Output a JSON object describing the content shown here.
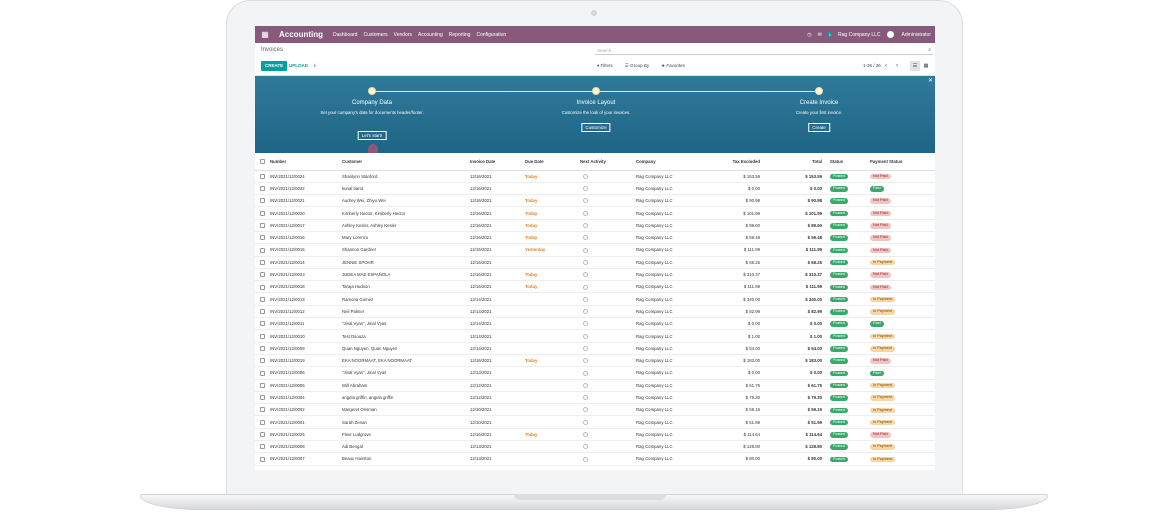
{
  "navbar": {
    "app_name": "Accounting",
    "menu": [
      "Dashboard",
      "Customers",
      "Vendors",
      "Accounting",
      "Reporting",
      "Configuration"
    ],
    "clock_icon": "clock-icon",
    "chat_count": "1",
    "company": "Rag Company LLC",
    "user": "Administrator"
  },
  "control": {
    "breadcrumb": "Invoices",
    "search_placeholder": "Search...",
    "create_label": "CREATE",
    "upload_label": "UPLOAD",
    "filters_label": "Filters",
    "groupby_label": "Group By",
    "favorites_label": "Favorites",
    "pager": "1-36 / 36"
  },
  "banner": {
    "steps": [
      {
        "title": "Company Data",
        "desc": "Set your company's data for documents header/footer.",
        "button": "Let's start!"
      },
      {
        "title": "Invoice Layout",
        "desc": "Customize the look of your invoices.",
        "button": "Customize"
      },
      {
        "title": "Create Invoice",
        "desc": "Create your first invoice.",
        "button": "Create"
      }
    ]
  },
  "table": {
    "headers": [
      "Number",
      "Customer",
      "Invoice Date",
      "Due Date",
      "Next Activity",
      "Company",
      "Tax Excluded",
      "Total",
      "Status",
      "Payment Status"
    ],
    "rows": [
      {
        "number": "INV/2021/12/0024",
        "customer": "Sharilynn Stanford",
        "date": "12/16/2021",
        "due": "Today",
        "company": "Rag Company LLC",
        "tax": "$ 153.59",
        "total": "$ 153.59",
        "status": "Posted",
        "payment": "Not Paid"
      },
      {
        "number": "INV/2021/12/0022",
        "customer": "kunal barot",
        "date": "12/16/2021",
        "due": "",
        "company": "Rag Company LLC",
        "tax": "$ 0.00",
        "total": "$ 0.00",
        "status": "Posted",
        "payment": "Paid"
      },
      {
        "number": "INV/2021/12/0021",
        "customer": "Audrey Wei, Zhiyu Wei",
        "date": "12/16/2021",
        "due": "Today",
        "company": "Rag Company LLC",
        "tax": "$ 90.98",
        "total": "$ 90.98",
        "status": "Posted",
        "payment": "Not Paid"
      },
      {
        "number": "INV/2021/12/0020",
        "customer": "Kimberly Hector, Kimberly Hector",
        "date": "12/16/2021",
        "due": "Today",
        "company": "Rag Company LLC",
        "tax": "$ 101.99",
        "total": "$ 101.99",
        "status": "Posted",
        "payment": "Not Paid"
      },
      {
        "number": "INV/2021/12/0017",
        "customer": "Ashley Kesler, Ashley Kesler",
        "date": "12/16/2021",
        "due": "Today",
        "company": "Rag Company LLC",
        "tax": "$ 89.60",
        "total": "$ 89.60",
        "status": "Posted",
        "payment": "Not Paid"
      },
      {
        "number": "INV/2021/12/0016",
        "customer": "Mary Lorenzo",
        "date": "12/16/2021",
        "due": "Today",
        "company": "Rag Company LLC",
        "tax": "$ 59.48",
        "total": "$ 59.48",
        "status": "Posted",
        "payment": "Not Paid"
      },
      {
        "number": "INV/2021/12/0015",
        "customer": "Shannon Gardner",
        "date": "12/15/2021",
        "due": "Yesterday",
        "company": "Rag Company LLC",
        "tax": "$ 111.99",
        "total": "$ 111.99",
        "status": "Posted",
        "payment": "Not Paid"
      },
      {
        "number": "INV/2021/12/0014",
        "customer": "JENNIE SPOHR",
        "date": "12/16/2021",
        "due": "",
        "company": "Rag Company LLC",
        "tax": "$ 68.25",
        "total": "$ 68.25",
        "status": "Posted",
        "payment": "In Payment"
      },
      {
        "number": "INV/2021/12/0023",
        "customer": "JUDEA MAE ESPAÑOLA",
        "date": "12/16/2021",
        "due": "Today",
        "company": "Rag Company LLC",
        "tax": "$ 310.37",
        "total": "$ 310.37",
        "status": "Posted",
        "payment": "Not Paid"
      },
      {
        "number": "INV/2021/12/0018",
        "customer": "Taraja Hudson",
        "date": "12/16/2021",
        "due": "Today",
        "company": "Rag Company LLC",
        "tax": "$ 111.99",
        "total": "$ 111.99",
        "status": "Posted",
        "payment": "Not Paid"
      },
      {
        "number": "INV/2021/12/0013",
        "customer": "Ramona Gomez",
        "date": "12/14/2021",
        "due": "",
        "company": "Rag Company LLC",
        "tax": "$ 340.00",
        "total": "$ 340.00",
        "status": "Posted",
        "payment": "In Payment"
      },
      {
        "number": "INV/2021/12/0012",
        "customer": "Neil Palmer",
        "date": "12/14/2021",
        "due": "",
        "company": "Rag Company LLC",
        "tax": "$ 82.99",
        "total": "$ 82.99",
        "status": "Posted",
        "payment": "In Payment"
      },
      {
        "number": "INV/2021/12/0011",
        "customer": "\"Jinal Vyas\", Jinal Vyas",
        "date": "12/14/2021",
        "due": "",
        "company": "Rag Company LLC",
        "tax": "$ 0.00",
        "total": "$ 0.00",
        "status": "Posted",
        "payment": "Paid"
      },
      {
        "number": "INV/2021/12/0010",
        "customer": "Test Dsouza",
        "date": "12/14/2021",
        "due": "",
        "company": "Rag Company LLC",
        "tax": "$ 1.00",
        "total": "$ 1.00",
        "status": "Posted",
        "payment": "In Payment"
      },
      {
        "number": "INV/2021/12/0009",
        "customer": "Quan Nguyen, Quan Nguyen",
        "date": "12/14/2021",
        "due": "",
        "company": "Rag Company LLC",
        "tax": "$ 54.00",
        "total": "$ 54.00",
        "status": "Posted",
        "payment": "In Payment"
      },
      {
        "number": "INV/2021/12/0019",
        "customer": "EKA NOORMAAT, EKA NOORMAAT",
        "date": "12/16/2021",
        "due": "Today",
        "company": "Rag Company LLC",
        "tax": "$ 183.00",
        "total": "$ 183.00",
        "status": "Posted",
        "payment": "Not Paid"
      },
      {
        "number": "INV/2021/12/0006",
        "customer": "\"Jinal Vyas\", Jinal Vyas",
        "date": "12/13/2021",
        "due": "",
        "company": "Rag Company LLC",
        "tax": "$ 0.00",
        "total": "$ 0.00",
        "status": "Posted",
        "payment": "Paid"
      },
      {
        "number": "INV/2021/12/0005",
        "customer": "Will Abraham",
        "date": "12/12/2021",
        "due": "",
        "company": "Rag Company LLC",
        "tax": "$ 61.75",
        "total": "$ 61.75",
        "status": "Posted",
        "payment": "In Payment"
      },
      {
        "number": "INV/2021/12/0004",
        "customer": "angela griffin, angela griffin",
        "date": "12/12/2021",
        "due": "",
        "company": "Rag Company LLC",
        "tax": "$ 79.30",
        "total": "$ 79.30",
        "status": "Posted",
        "payment": "In Payment"
      },
      {
        "number": "INV/2021/12/0002",
        "customer": "Margeret Orisman",
        "date": "12/10/2021",
        "due": "",
        "company": "Rag Company LLC",
        "tax": "$ 59.15",
        "total": "$ 59.15",
        "status": "Posted",
        "payment": "In Payment"
      },
      {
        "number": "INV/2021/12/0001",
        "customer": "Sarah Zenan",
        "date": "12/10/2021",
        "due": "",
        "company": "Rag Company LLC",
        "tax": "$ 51.99",
        "total": "$ 51.99",
        "status": "Posted",
        "payment": "In Payment"
      },
      {
        "number": "INV/2021/12/0025",
        "customer": "Fleur Ludgrove",
        "date": "12/16/2021",
        "due": "Today",
        "company": "Rag Company LLC",
        "tax": "$ 114.64",
        "total": "$ 114.64",
        "status": "Posted",
        "payment": "Not Paid"
      },
      {
        "number": "INV/2021/12/0008",
        "customer": "Adi Bengal",
        "date": "12/13/2021",
        "due": "",
        "company": "Rag Company LLC",
        "tax": "$ 128.80",
        "total": "$ 128.80",
        "status": "Posted",
        "payment": "In Payment"
      },
      {
        "number": "INV/2021/12/0007",
        "customer": "Beaux Hairston",
        "date": "12/13/2021",
        "due": "",
        "company": "Rag Company LLC",
        "tax": "$ 80.00",
        "total": "$ 80.00",
        "status": "Posted",
        "payment": "In Payment"
      }
    ]
  },
  "colors": {
    "brand": "#875a7b",
    "accent": "#00a09d",
    "banner": "#2a7295",
    "due": "#e67e22"
  }
}
